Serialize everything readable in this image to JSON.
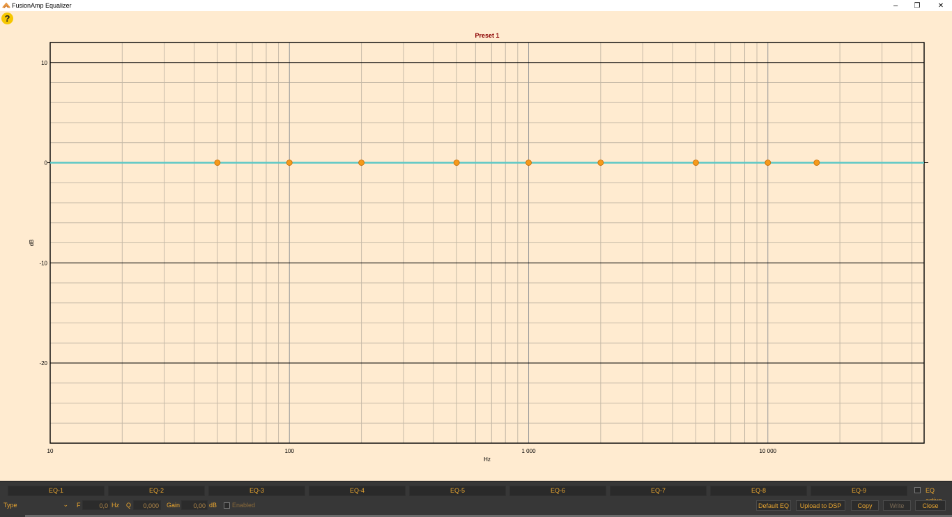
{
  "window": {
    "title": "FusionAmp Equalizer",
    "minimize_glyph": "–",
    "restore_glyph": "❐",
    "close_glyph": "✕"
  },
  "help": {
    "glyph": "?"
  },
  "chart_data": {
    "type": "line",
    "title": "Preset 1",
    "xlabel": "Hz",
    "ylabel": "dB",
    "xscale": "log",
    "xlim": [
      10,
      45000
    ],
    "ylim": [
      -28,
      12
    ],
    "x_ticks": [
      10,
      100,
      1000,
      10000
    ],
    "x_tick_labels": [
      "10",
      "100",
      "1 000",
      "10 000"
    ],
    "y_ticks": [
      10,
      0,
      -10,
      -20
    ],
    "y_tick_labels": [
      "10",
      "0",
      "-10",
      "-20"
    ],
    "grid": true,
    "series": [
      {
        "x": [
          10,
          45000
        ],
        "y": [
          0,
          0
        ],
        "color": "#5bc8c5"
      }
    ],
    "eq_points": {
      "x": [
        50,
        100,
        200,
        500,
        1000,
        2000,
        5000,
        10000,
        16000
      ],
      "y": [
        0,
        0,
        0,
        0,
        0,
        0,
        0,
        0,
        0
      ],
      "color": "#f59a1b"
    }
  },
  "eq_tabs": [
    "EQ-1",
    "EQ-2",
    "EQ-3",
    "EQ-4",
    "EQ-5",
    "EQ-6",
    "EQ-7",
    "EQ-8",
    "EQ-9"
  ],
  "eq_active": {
    "label": "EQ active",
    "checked": false
  },
  "controls": {
    "type_label": "Type",
    "f_label": "F",
    "f_value": "0,0",
    "hz_unit": "Hz",
    "q_label": "Q",
    "q_value": "0,000",
    "gain_label": "Gain",
    "gain_value": "0,00",
    "db_unit": "dB",
    "enabled_label": "Enabled"
  },
  "buttons": {
    "default_eq": "Default EQ",
    "upload": "Upload to DSP",
    "copy": "Copy",
    "write": "Write",
    "close": "Close"
  }
}
